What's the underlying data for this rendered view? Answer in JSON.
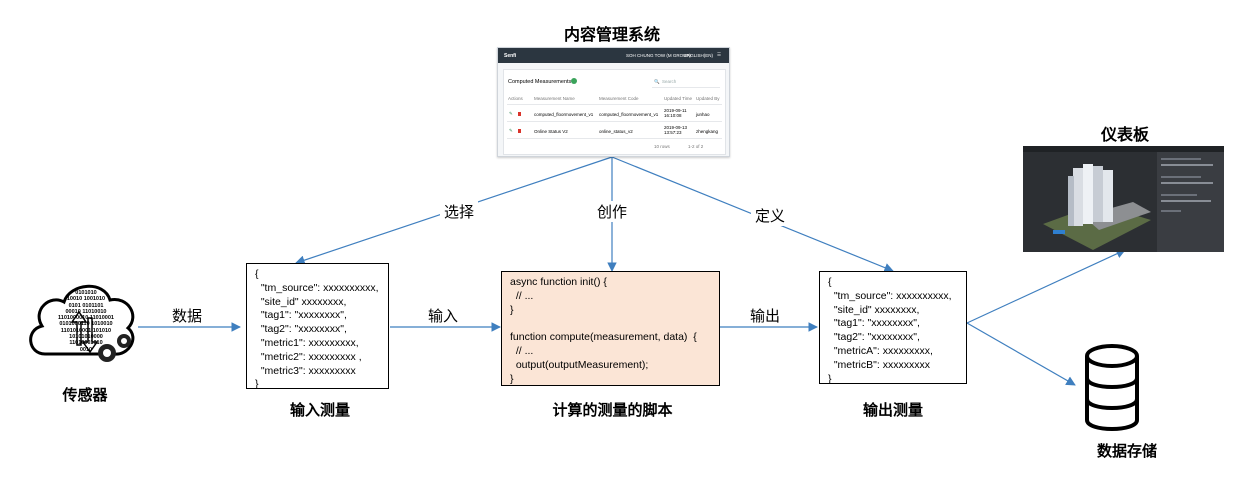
{
  "titles": {
    "cms": "内容管理系统",
    "dashboard": "仪表板",
    "sensor": "传感器",
    "input_measurement": "输入测量",
    "script": "计算的测量的脚本",
    "output_measurement": "输出测量",
    "storage": "数据存储"
  },
  "edges": {
    "data": "数据",
    "input": "输入",
    "output": "输出",
    "select": "选择",
    "author": "创作",
    "define": "定义"
  },
  "sensor_binary": [
    "0101010",
    "10010 1001010",
    "0101 0101101",
    "00010 11010010",
    "1101000010 11010001",
    "0101000110 1010010",
    "1101010001 101010",
    "10101010000",
    "11010001010",
    "0010"
  ],
  "input_box": [
    "{",
    "  \"tm_source\": xxxxxxxxxx,",
    "  \"site_id\" xxxxxxxx,",
    "  \"tag1\": \"xxxxxxxx\",",
    "  \"tag2\": \"xxxxxxxx\",",
    "  \"metric1\": xxxxxxxxx,",
    "  \"metric2\": xxxxxxxxx ,",
    "  \"metric3\": xxxxxxxxx",
    "}"
  ],
  "script_box": [
    "async function init() {",
    "  // ...",
    "}",
    "",
    "function compute(measurement, data)  {",
    "  // ...",
    "  output(outputMeasurement);",
    "}"
  ],
  "output_box": [
    "{",
    "  \"tm_source\": xxxxxxxxxx,",
    "  \"site_id\" xxxxxxxx,",
    "  \"tag1\": \"xxxxxxxx\",",
    "  \"tag2\": \"xxxxxxxx\",",
    "  \"metricA\": xxxxxxxxx,",
    "  \"metricB\": xxxxxxxxx",
    "}"
  ],
  "cms_screen": {
    "logo": "Senfi",
    "user": "SOH CHUNG TOW (M GROUP)",
    "lang": "ENGLISH(EN)",
    "card_title": "Computed Measurements",
    "search_placeholder": "Search",
    "columns": [
      "Actions",
      "Measurement Name",
      "Measurement Code",
      "Updated Time",
      "Updated By"
    ],
    "rows": [
      [
        "computed_floormovement_v1",
        "computed_floormovement_v1",
        "2019-09-11 16:10:08",
        "junhao"
      ],
      [
        "Online Status V2",
        "online_status_v2",
        "2019-09-13 13:57:23",
        "zhengkang"
      ]
    ],
    "pagination": "10 rows",
    "page_info": "1-2 of 2"
  },
  "colors": {
    "arrow": "#3f7fbf",
    "script_fill": "#fbe5d6",
    "box_border": "#000000",
    "sensor_icon": "#000000"
  }
}
